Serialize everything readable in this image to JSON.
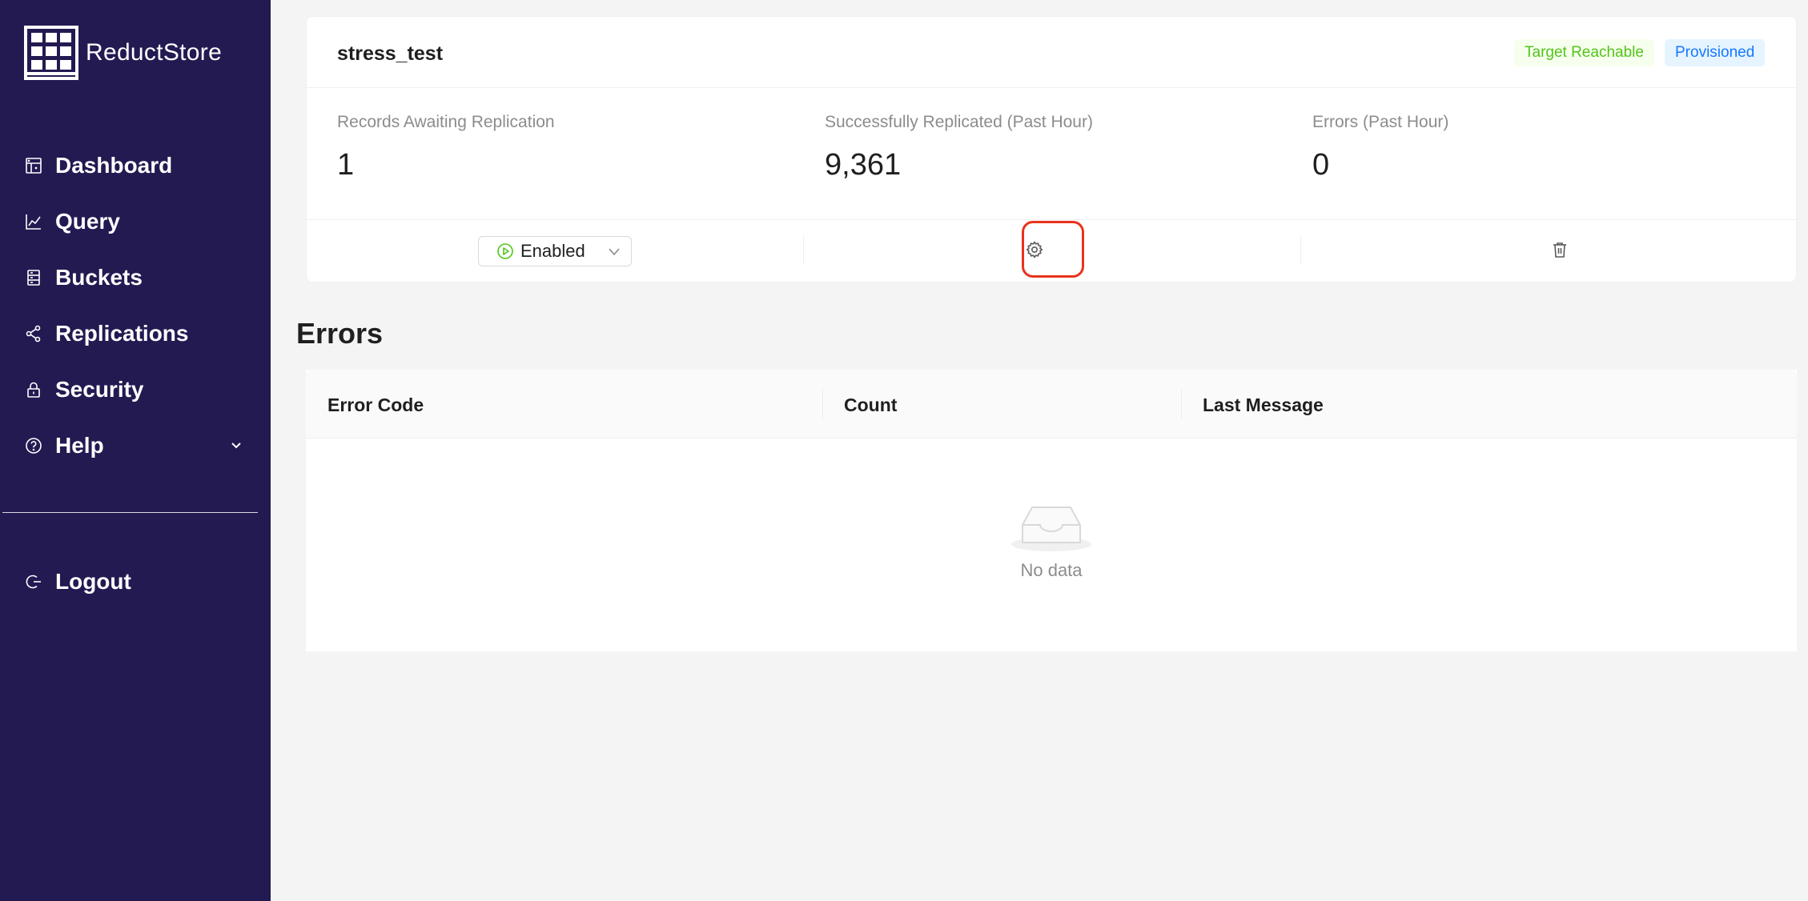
{
  "brand": {
    "name": "ReductStore",
    "logo_icon": "reductstore-logo-icon"
  },
  "sidebar": {
    "items": [
      {
        "label": "Dashboard",
        "icon": "dashboard-icon"
      },
      {
        "label": "Query",
        "icon": "line-chart-icon"
      },
      {
        "label": "Buckets",
        "icon": "database-icon"
      },
      {
        "label": "Replications",
        "icon": "share-icon"
      },
      {
        "label": "Security",
        "icon": "lock-icon"
      },
      {
        "label": "Help",
        "icon": "question-circle-icon",
        "expandable": true
      }
    ],
    "logout": {
      "label": "Logout",
      "icon": "logout-icon"
    },
    "background": "#231a52"
  },
  "replication": {
    "name": "stress_test",
    "tags": {
      "reachable": {
        "label": "Target Reachable",
        "color": "#52c41a"
      },
      "provisioned": {
        "label": "Provisioned",
        "color": "#1677ff"
      }
    },
    "stats": [
      {
        "label": "Records Awaiting Replication",
        "value": "1"
      },
      {
        "label": "Successfully Replicated (Past Hour)",
        "value": "9,361"
      },
      {
        "label": "Errors (Past Hour)",
        "value": "0"
      }
    ],
    "mode_select": {
      "value": "Enabled",
      "icon": "play-circle-icon"
    },
    "actions": {
      "settings_icon": "gear-icon",
      "delete_icon": "trash-icon"
    },
    "highlight_color": "#e8331c"
  },
  "errors": {
    "title": "Errors",
    "columns": [
      "Error Code",
      "Count",
      "Last Message"
    ],
    "rows": [],
    "empty_text": "No data"
  }
}
